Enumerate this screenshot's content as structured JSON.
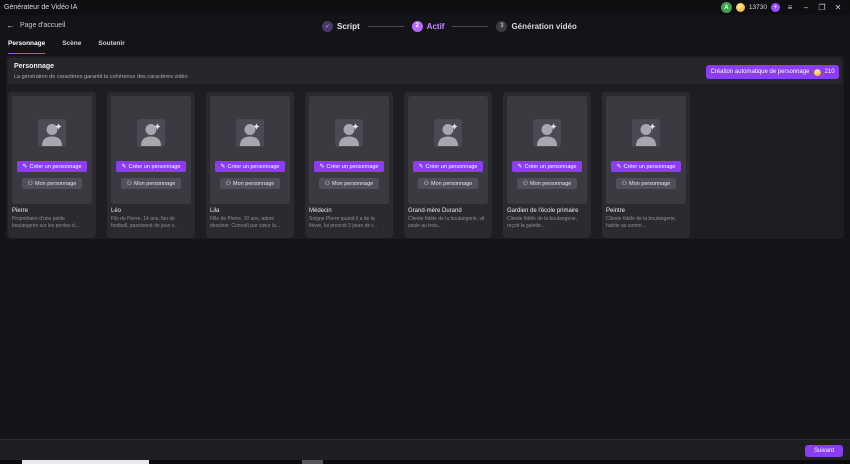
{
  "window": {
    "title": "Générateur de Vidéo IA",
    "avatar_letter": "A",
    "credits": "13730",
    "plus_symbol": "+"
  },
  "header": {
    "back_label": "Page d'accueil",
    "steps": [
      {
        "number": "✓",
        "label": "Script",
        "state": "done"
      },
      {
        "number": "2",
        "label": "Actif",
        "state": "active"
      },
      {
        "number": "3",
        "label": "Génération vidéo",
        "state": "pending"
      }
    ]
  },
  "tabs": [
    {
      "label": "Personnage",
      "active": true
    },
    {
      "label": "Scène",
      "active": false
    },
    {
      "label": "Soutenir",
      "active": false
    }
  ],
  "panel": {
    "title": "Personnage",
    "subtitle": "La génération de caractères garantit la cohérence des caractères vidéo",
    "auto_button_label": "Création automatique de personnage",
    "auto_button_cost": "210"
  },
  "card_buttons": {
    "create_label": "Créer un personnage",
    "mine_label": "Mon personnage"
  },
  "characters": [
    {
      "name": "Pierre",
      "description": "Propriétaire d'une petite boulangerie sur les pentes d..."
    },
    {
      "name": "Léo",
      "description": "Fils de Pierre, 14 ans, fan de football, passionné de jeux v..."
    },
    {
      "name": "Lila",
      "description": "Fille de Pierre, 10 ans, adore dessiner. Connaît par cœur la..."
    },
    {
      "name": "Médecin",
      "description": "Soigne Pierre quand il a de la fièvre, lui prescrit 3 jours de r..."
    },
    {
      "name": "Grand-mère Durand",
      "description": "Cliente fidèle de la boulangerie, vit seule au trois..."
    },
    {
      "name": "Gardien de l'école primaire",
      "description": "Cliente fidèle de la boulangerie, reçoit la galette..."
    },
    {
      "name": "Peintre",
      "description": "Cliente fidèle de la boulangerie, habite au somm..."
    }
  ],
  "footer": {
    "next_label": "Suivant"
  },
  "icons": {
    "back": "arrow-left-icon",
    "create": "pencil-icon",
    "mine": "user-icon",
    "coin": "coin-icon"
  },
  "colors": {
    "accent": "#8a3df2",
    "active_step": "#b769ff",
    "background": "#141418"
  }
}
